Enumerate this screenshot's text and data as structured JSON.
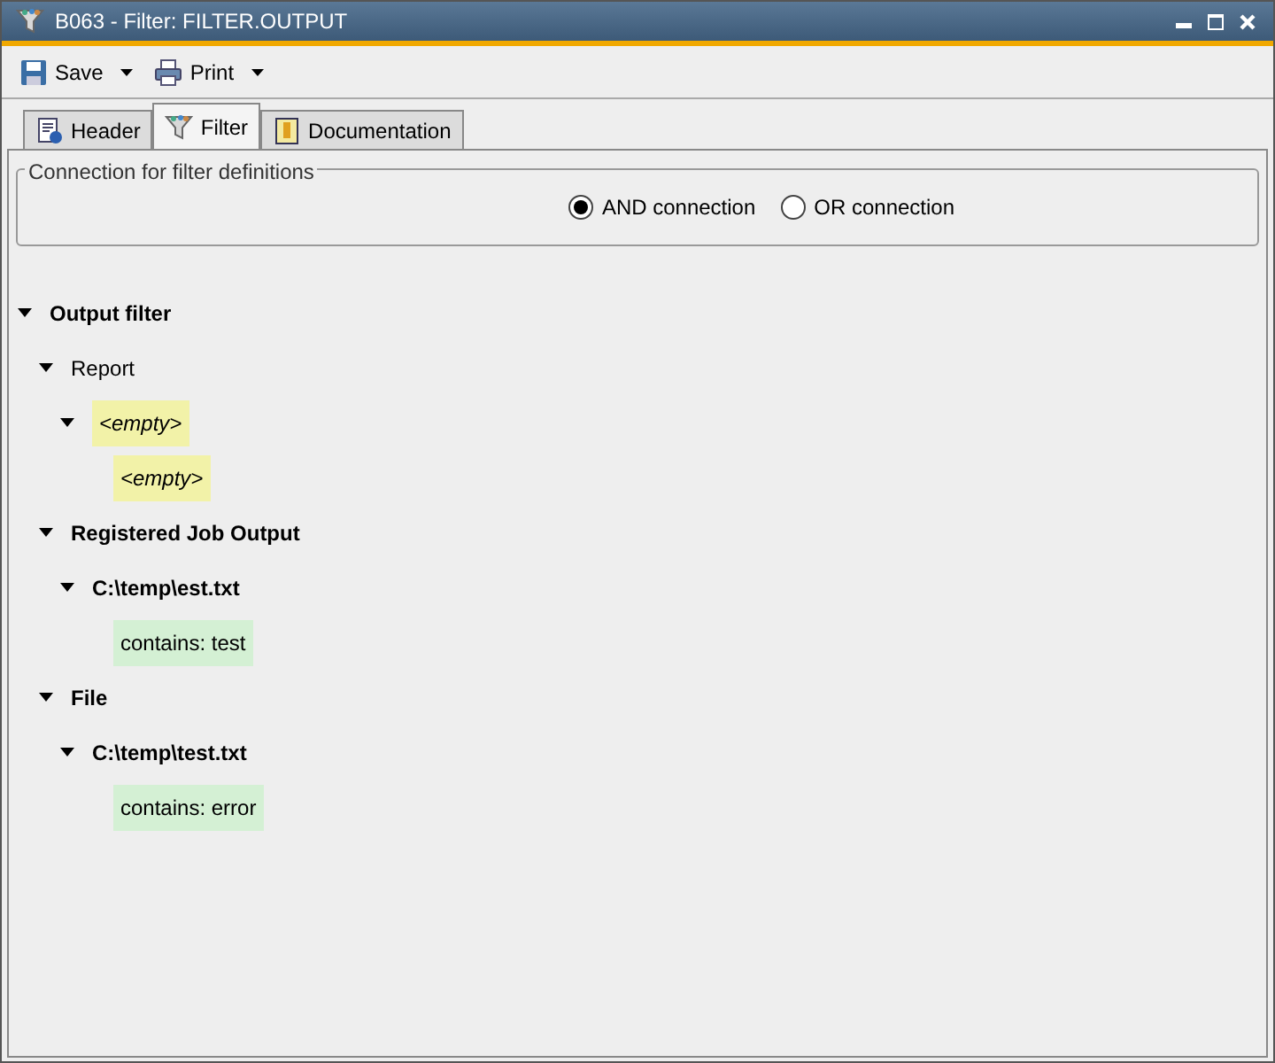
{
  "window": {
    "title": "B063 - Filter: FILTER.OUTPUT"
  },
  "toolbar": [
    {
      "label": "Save",
      "kind": "save"
    },
    {
      "label": "Print",
      "kind": "print"
    }
  ],
  "tabs": [
    {
      "label": "Header",
      "kind": "header",
      "selected": false
    },
    {
      "label": "Filter",
      "kind": "filter",
      "selected": true
    },
    {
      "label": "Documentation",
      "kind": "doc",
      "selected": false
    }
  ],
  "connection": {
    "title": "Connection for filter definitions",
    "options": [
      {
        "label": "AND connection",
        "selected": true
      },
      {
        "label": "OR connection",
        "selected": false
      }
    ]
  },
  "tree": [
    {
      "label": "Output filter",
      "kind": "group",
      "bold": true,
      "expanded": true,
      "children": [
        {
          "label": "Report",
          "kind": "group",
          "bold": false,
          "expanded": true,
          "children": [
            {
              "label": "<empty>",
              "kind": "empty",
              "expanded": true,
              "children": [
                {
                  "label": "<empty>",
                  "kind": "empty"
                }
              ]
            }
          ]
        },
        {
          "label": "Registered Job Output",
          "kind": "group",
          "bold": true,
          "expanded": true,
          "children": [
            {
              "label": "C:\\temp\\est.txt",
              "kind": "group",
              "bold": true,
              "expanded": true,
              "children": [
                {
                  "label": "contains: test",
                  "kind": "condition"
                }
              ]
            }
          ]
        },
        {
          "label": "File",
          "kind": "group",
          "bold": true,
          "expanded": true,
          "children": [
            {
              "label": "C:\\temp\\test.txt",
              "kind": "group",
              "bold": true,
              "expanded": true,
              "children": [
                {
                  "label": "contains: error",
                  "kind": "condition"
                }
              ]
            }
          ]
        }
      ]
    }
  ]
}
